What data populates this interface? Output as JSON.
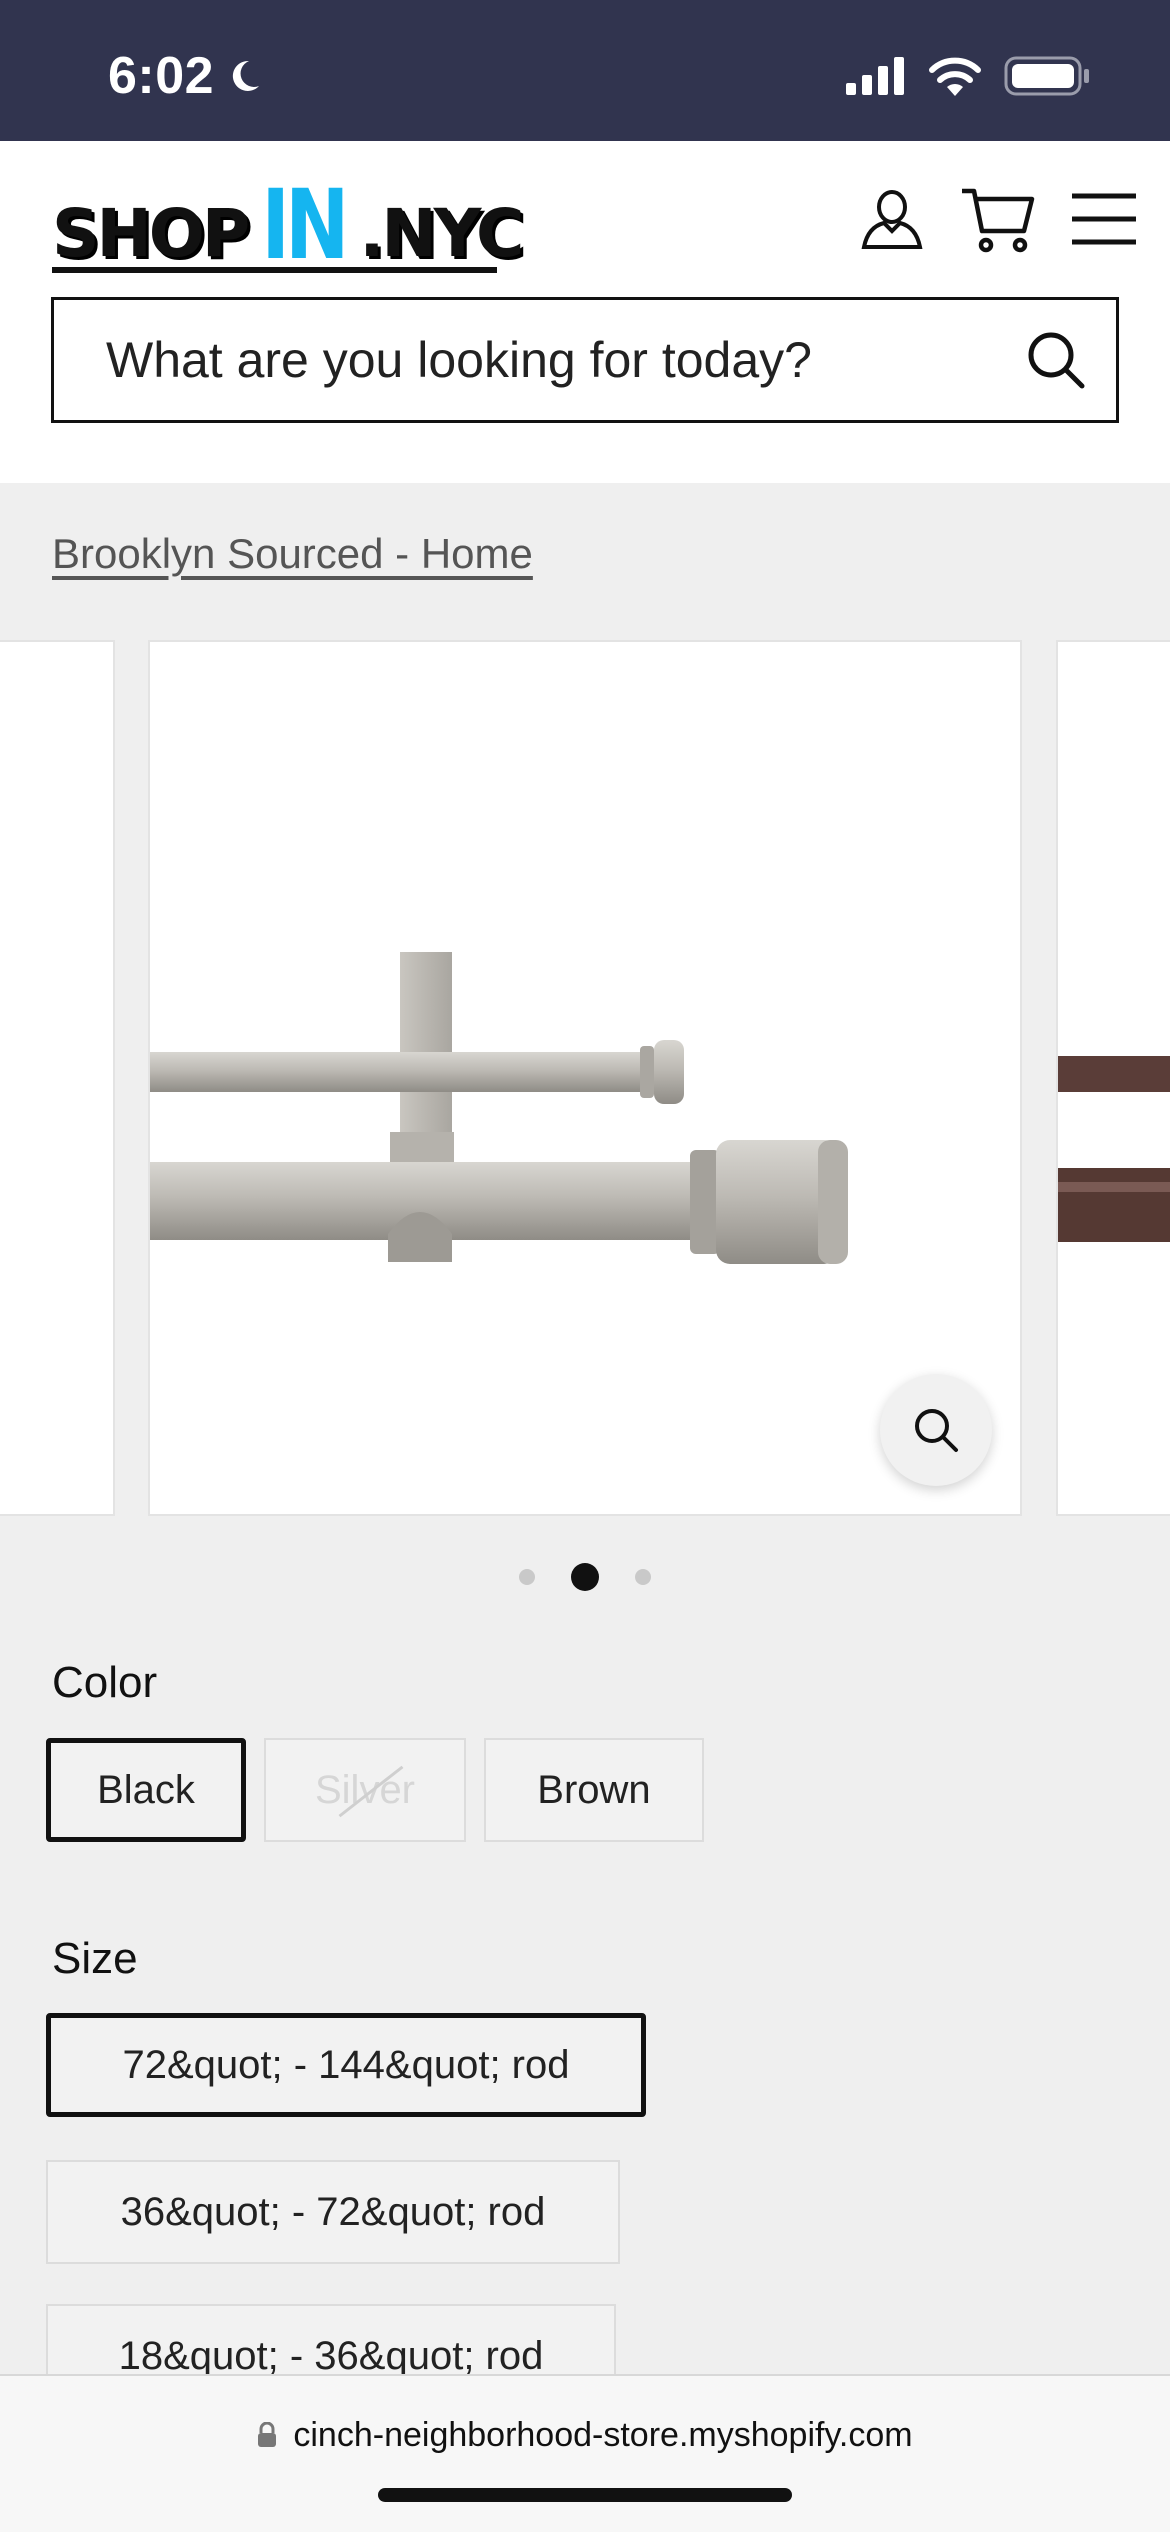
{
  "status_bar": {
    "time": "6:02"
  },
  "header": {
    "logo": {
      "part1": "SHOP",
      "part2": "IN",
      "part3": ".NYC"
    },
    "search_placeholder": "What are you looking for today?",
    "icons": [
      "account-icon",
      "cart-icon",
      "menu-icon"
    ]
  },
  "breadcrumb": "Brooklyn Sourced - Home",
  "gallery": {
    "slide_count": 3,
    "active_index": 1
  },
  "color": {
    "label": "Color",
    "options": [
      {
        "label": "Black",
        "state": "selected"
      },
      {
        "label": "Silver",
        "state": "unavailable"
      },
      {
        "label": "Brown",
        "state": "available"
      }
    ]
  },
  "size": {
    "label": "Size",
    "options": [
      {
        "label": "72&quot; - 144&quot; rod",
        "state": "selected"
      },
      {
        "label": "36&quot; - 72&quot; rod",
        "state": "available"
      },
      {
        "label": "18&quot; - 36&quot; rod",
        "state": "available"
      }
    ]
  },
  "browser": {
    "url": "cinch-neighborhood-store.myshopify.com"
  },
  "colors": {
    "status_bar_bg": "#31344f",
    "logo_accent": "#15b5f0",
    "page_bg": "#efefef"
  }
}
